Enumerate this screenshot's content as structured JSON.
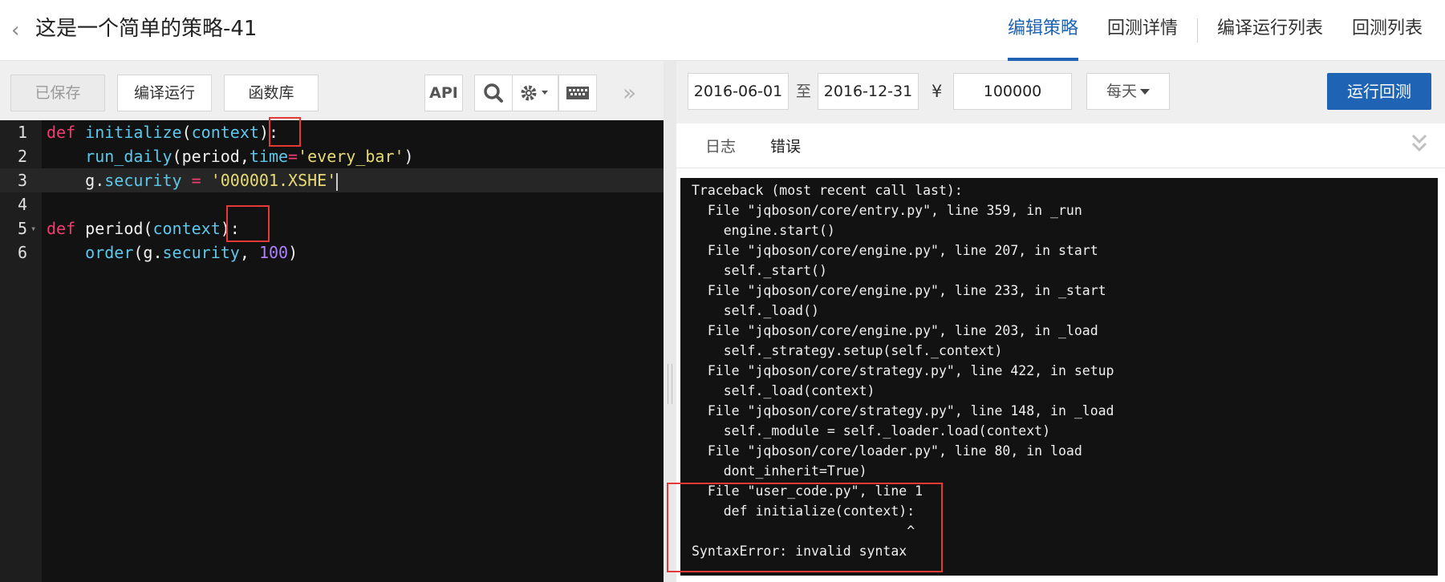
{
  "header": {
    "title": "这是一个简单的策略-41",
    "nav": [
      "编辑策略",
      "回测详情",
      "编译运行列表",
      "回测列表"
    ],
    "active_nav": "编辑策略"
  },
  "toolbar": {
    "saved_label": "已保存",
    "compile_label": "编译运行",
    "library_label": "函数库",
    "api_label": "API"
  },
  "editor": {
    "line_numbers": [
      "1",
      "2",
      "3",
      "4",
      "5",
      "6"
    ]
  },
  "backtest": {
    "start_date": "2016-06-01",
    "to_label": "至",
    "end_date": "2016-12-31",
    "currency_symbol": "¥",
    "capital": "100000",
    "frequency": "每天",
    "run_label": "运行回测"
  },
  "tabs": [
    "日志",
    "错误"
  ],
  "active_tab": "错误",
  "console_lines": [
    "Traceback (most recent call last):",
    "  File \"jqboson/core/entry.py\", line 359, in _run",
    "    engine.start()",
    "  File \"jqboson/core/engine.py\", line 207, in start",
    "    self._start()",
    "  File \"jqboson/core/engine.py\", line 233, in _start",
    "    self._load()",
    "  File \"jqboson/core/engine.py\", line 203, in _load",
    "    self._strategy.setup(self._context)",
    "  File \"jqboson/core/strategy.py\", line 422, in setup",
    "    self._load(context)",
    "  File \"jqboson/core/strategy.py\", line 148, in _load",
    "    self._module = self._loader.load(context)",
    "  File \"jqboson/core/loader.py\", line 80, in load",
    "    dont_inherit=True)",
    "  File \"user_code.py\", line 1",
    "    def initialize(context):",
    "                           ^",
    "SyntaxError: invalid syntax"
  ],
  "colors": {
    "accent": "#1f63b5",
    "highlight_box": "#e53935",
    "keyword": "#f03c6e",
    "function": "#5ec8ea",
    "string": "#e6db74",
    "number": "#ae81ff"
  }
}
